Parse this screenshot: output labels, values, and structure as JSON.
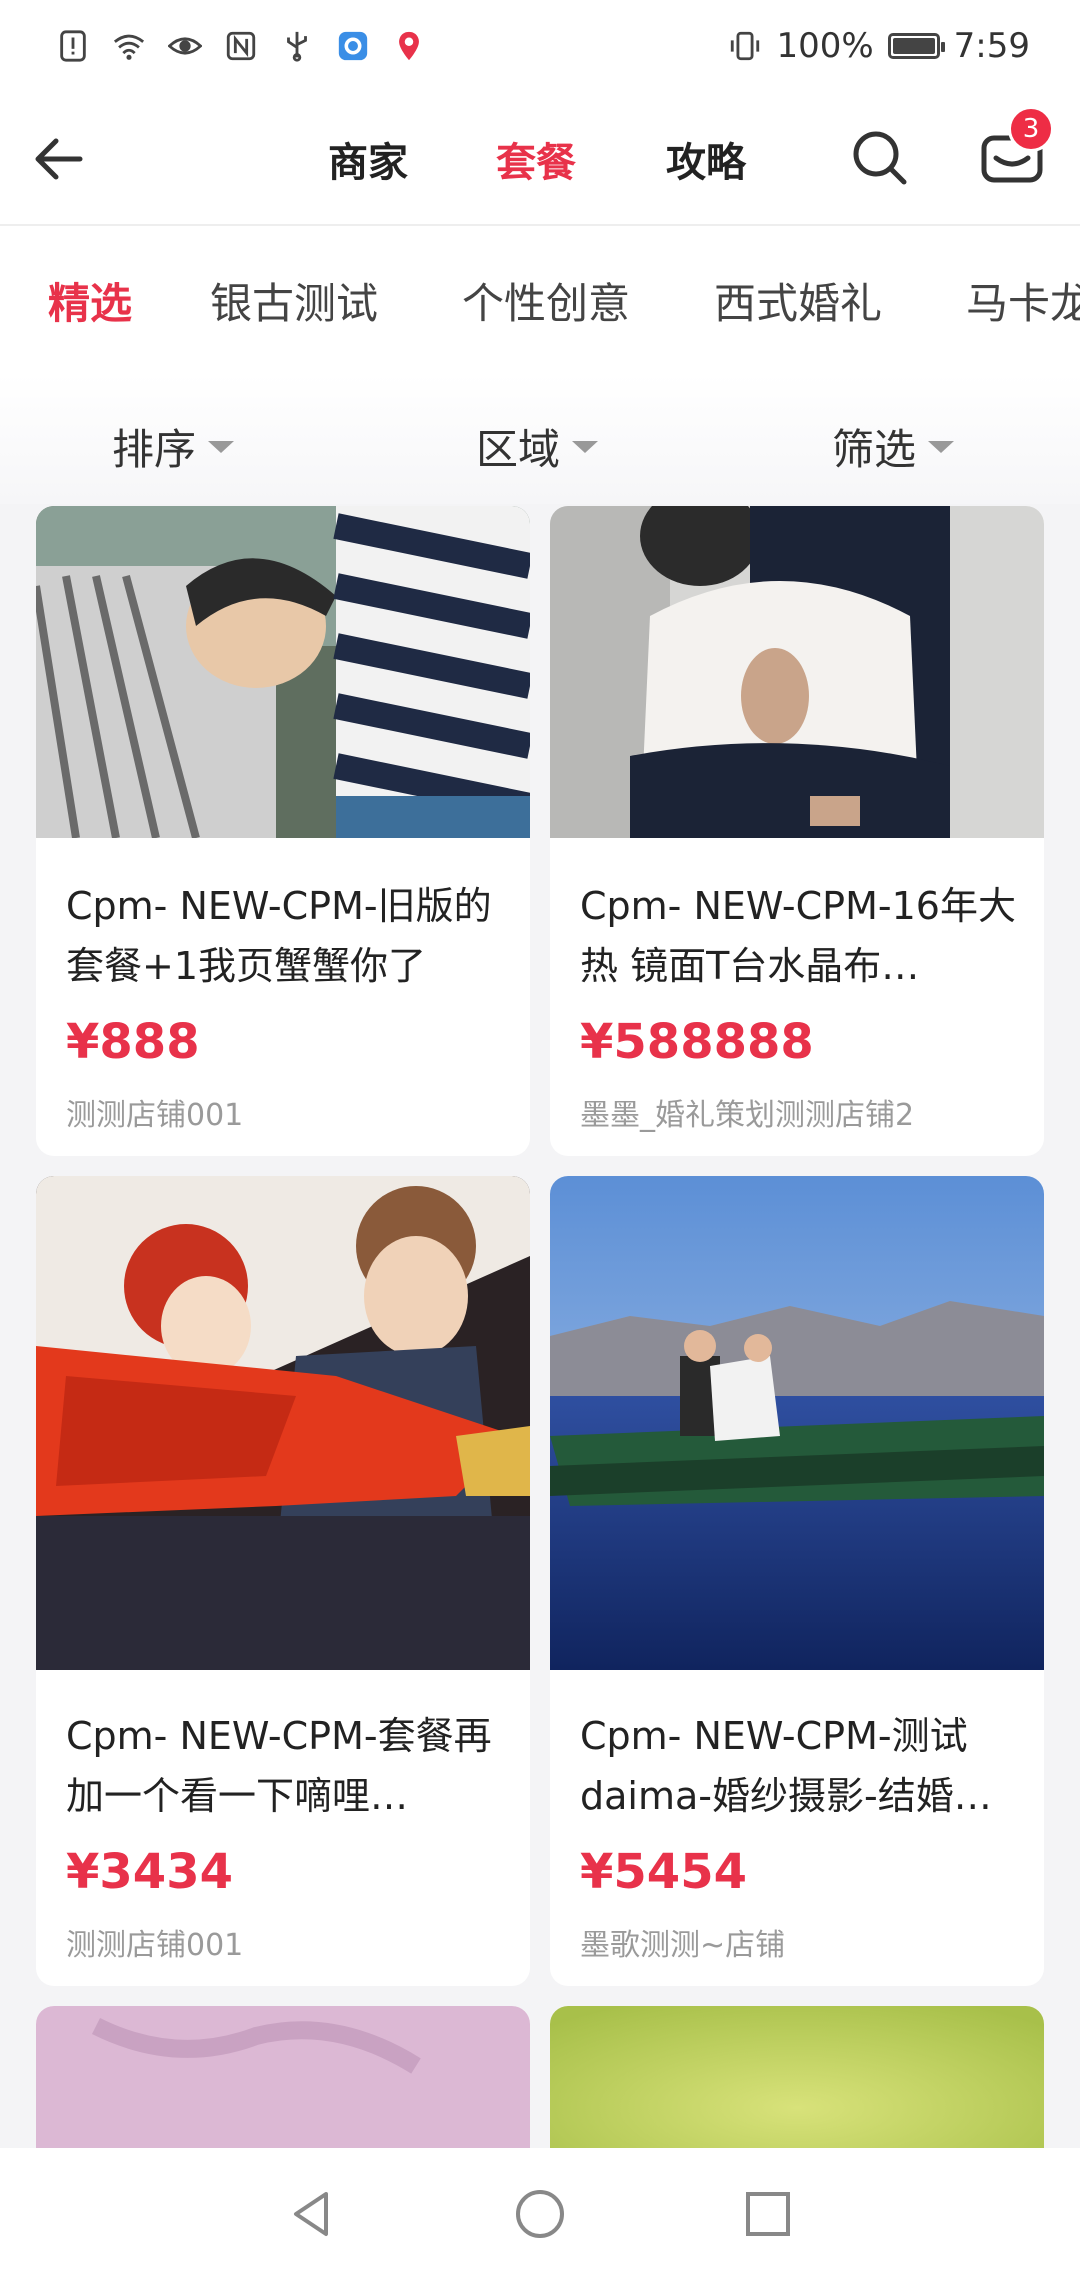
{
  "status": {
    "battery_text": "100%",
    "time": "7:59"
  },
  "nav": {
    "tabs": [
      "商家",
      "套餐",
      "攻略"
    ],
    "active_tab": "套餐",
    "mail_badge": "3"
  },
  "categories": [
    "精选",
    "银古测试",
    "个性创意",
    "西式婚礼",
    "马卡龙"
  ],
  "filters": [
    "排序",
    "区域",
    "筛选"
  ],
  "cards": [
    {
      "title": "Cpm- NEW-CPM-旧版的套餐+1我页蟹蟹你了",
      "price": "¥888",
      "shop": "测测店铺001"
    },
    {
      "title": "Cpm- NEW-CPM-16年大热 镜面T台水晶布…",
      "price": "¥588888",
      "shop": "墨墨_婚礼策划测测店铺2"
    },
    {
      "title": "Cpm- NEW-CPM-套餐再加一个看一下嘀哩…",
      "price": "¥3434",
      "shop": "测测店铺001"
    },
    {
      "title": "Cpm- NEW-CPM-测试daima-婚纱摄影-结婚…",
      "price": "¥5454",
      "shop": "墨歌测测~店铺"
    }
  ],
  "colors": {
    "accent": "#e8324a",
    "badge": "#ee2d45"
  }
}
